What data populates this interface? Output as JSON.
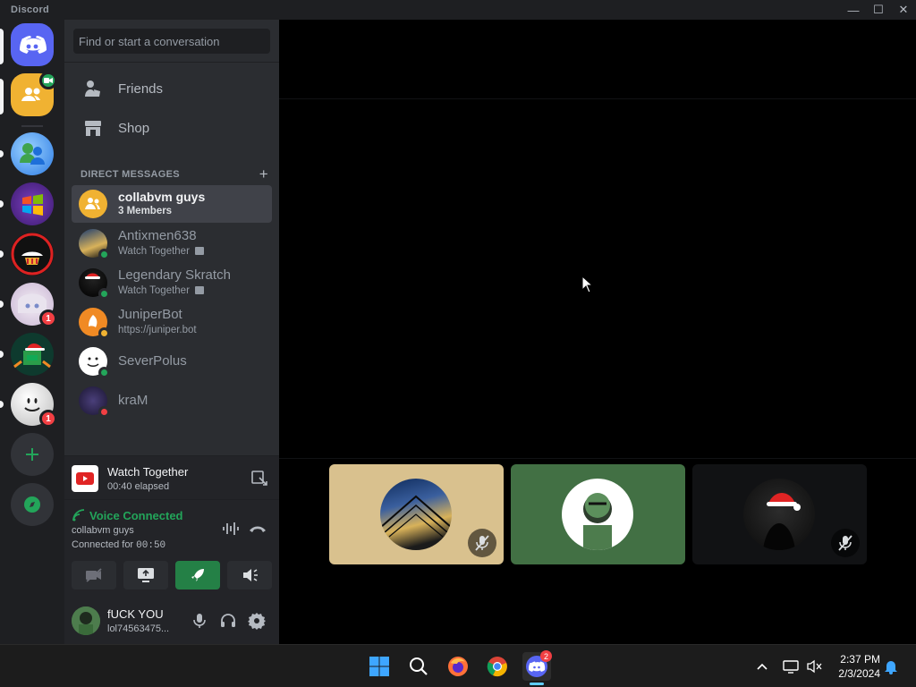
{
  "window": {
    "app_name": "Discord",
    "controls": {
      "minimize": "—",
      "maximize": "☐",
      "close": "✕"
    }
  },
  "rail": {
    "servers": [
      {
        "name": "home",
        "icon": "discord-logo-icon"
      },
      {
        "name": "group-dm",
        "icon": "group-icon",
        "badge": ""
      },
      {
        "name": "server-msn",
        "icon": "msn-icon",
        "badge": ""
      },
      {
        "name": "server-windows",
        "icon": "windows-logo-icon",
        "badge": ""
      },
      {
        "name": "server-red",
        "icon": "red-hat-icon",
        "badge": ""
      },
      {
        "name": "server-anime",
        "icon": "anime-avatar-icon",
        "badge": "1"
      },
      {
        "name": "server-xmas",
        "icon": "christmas-avatar-icon",
        "badge": ""
      },
      {
        "name": "server-smiley",
        "icon": "smiley-icon",
        "badge": "1"
      }
    ],
    "add_server_icon": "plus-icon",
    "explore_icon": "compass-icon"
  },
  "sidebar": {
    "search_placeholder": "Find or start a conversation",
    "nav": [
      {
        "label": "Friends",
        "icon": "friends-icon"
      },
      {
        "label": "Shop",
        "icon": "shop-icon"
      }
    ],
    "dm_header": "DIRECT MESSAGES",
    "dm_add": "+",
    "dms": [
      {
        "name": "collabvm guys",
        "sub": "3 Members",
        "status": "",
        "active": true
      },
      {
        "name": "Antixmen638",
        "sub": "Watch Together",
        "status": "online"
      },
      {
        "name": "Legendary Skratch",
        "sub": "Watch Together",
        "status": "online"
      },
      {
        "name": "JuniperBot",
        "sub": "https://juniper.bot",
        "status": "idle"
      },
      {
        "name": "SeverPolus",
        "sub": "",
        "status": "online"
      },
      {
        "name": "kraM",
        "sub": "",
        "status": "dnd"
      }
    ]
  },
  "activity": {
    "title": "Watch Together",
    "elapsed": "00:40 elapsed"
  },
  "voice": {
    "status": "Voice Connected",
    "channel": "collabvm guys",
    "connected_prefix": "Connected for ",
    "connected_time": "00:50"
  },
  "user": {
    "name": "fUCK YOU",
    "tag": "lol74563475..."
  },
  "taskbar": {
    "apps": [
      "windows-start-icon",
      "search-icon",
      "firefox-icon",
      "chrome-icon",
      "discord-icon"
    ],
    "discord_badge": "2",
    "time": "2:37 PM",
    "date": "2/3/2024"
  },
  "colors": {
    "blurple": "#5865f2",
    "green": "#23a55a",
    "red": "#f23f43",
    "idle": "#f0b232"
  }
}
